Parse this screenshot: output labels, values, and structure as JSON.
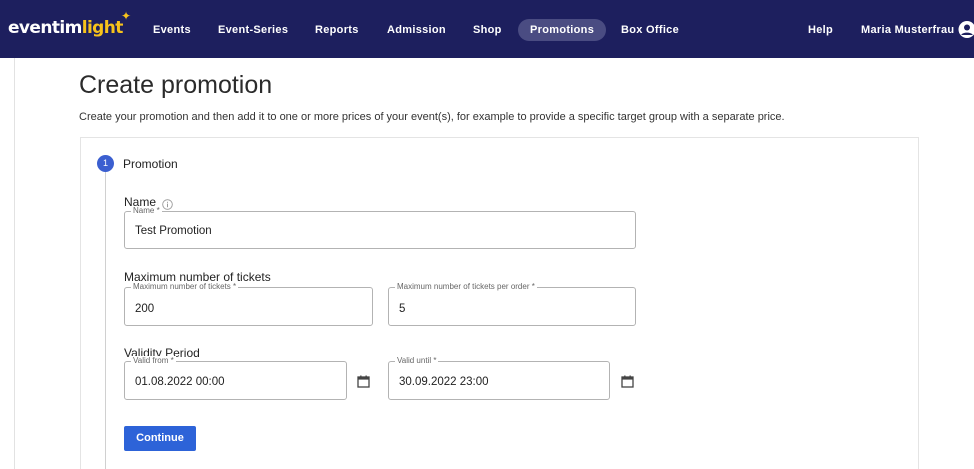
{
  "app": {
    "logo_part1": "eventim",
    "logo_part2": "light",
    "logo_star": "✦"
  },
  "nav": {
    "items": [
      {
        "label": "Events"
      },
      {
        "label": "Event-Series"
      },
      {
        "label": "Reports"
      },
      {
        "label": "Admission"
      },
      {
        "label": "Shop"
      },
      {
        "label": "Promotions",
        "active": true
      },
      {
        "label": "Box Office"
      }
    ],
    "help": "Help",
    "user_name": "Maria Musterfrau",
    "user_icon": "user-circle-icon"
  },
  "page": {
    "title": "Create promotion",
    "subtitle": "Create your promotion and then add it to one or more prices of your event(s), for example to provide a specific target group with a separate price."
  },
  "step": {
    "number": "1",
    "title": "Promotion"
  },
  "form": {
    "name_group": {
      "label": "Name",
      "info_icon": "info-icon",
      "field_label": "Name *",
      "value": "Test Promotion"
    },
    "tickets_group": {
      "label": "Maximum number of tickets",
      "max_tickets_label": "Maximum number of tickets *",
      "max_tickets_value": "200",
      "max_per_order_label": "Maximum number of tickets per order *",
      "max_per_order_value": "5"
    },
    "validity_group": {
      "label": "Validity Period",
      "valid_from_label": "Valid from *",
      "valid_from_value": "01.08.2022 00:00",
      "valid_until_label": "Valid until *",
      "valid_until_value": "30.09.2022 23:00",
      "calendar_icon": "calendar-icon"
    },
    "continue_label": "Continue"
  },
  "colors": {
    "topbar": "#1d1f5e",
    "accent": "#2d63d8",
    "logo_accent": "#f7c21b"
  }
}
